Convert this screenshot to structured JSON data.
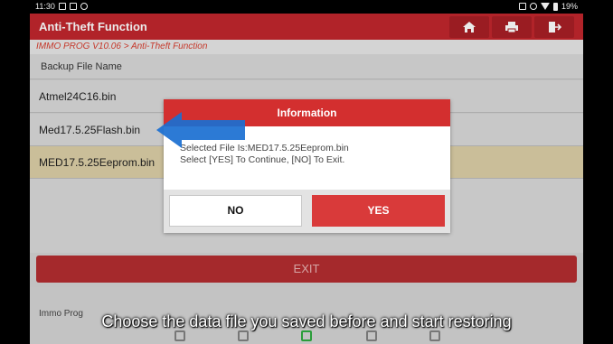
{
  "status_bar": {
    "time": "11:30",
    "battery": "19%"
  },
  "app": {
    "title": "Anti-Theft Function",
    "breadcrumb": "IMMO PROG V10.06 > Anti-Theft Function"
  },
  "list": {
    "header": "Backup File Name",
    "files": [
      "Atmel24C16.bin",
      "Med17.5.25Flash.bin",
      "MED17.5.25Eeprom.bin"
    ],
    "selected_index": 2
  },
  "exit_label": "EXIT",
  "footer_label": "Immo Prog",
  "dialog": {
    "title": "Information",
    "message_line1": "Selected File Is:MED17.5.25Eeprom.bin",
    "message_line2": "Select [YES] To Continue, [NO] To Exit.",
    "no_label": "NO",
    "yes_label": "YES"
  },
  "caption": "Choose the data file you saved before and start restoring",
  "toolbar_icons": [
    "home-icon",
    "print-icon",
    "exit-door-icon"
  ],
  "colors": {
    "title_bar": "#c1272d",
    "dialog_header": "#d32f2f",
    "yes_button": "#d93a3a",
    "arrow": "#1a6fd1",
    "selected_row": "#dccfa6"
  }
}
